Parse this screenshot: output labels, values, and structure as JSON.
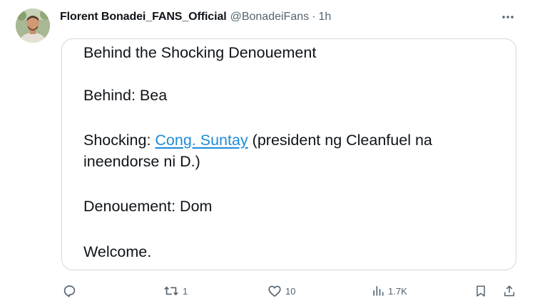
{
  "tweet": {
    "author": {
      "display_name": "Florent Bonadei_FANS_Official",
      "handle": "@BonadeiFans",
      "separator": "·",
      "time": "1h"
    },
    "card_lines": {
      "title": "Behind the Shocking Denouement",
      "behind": "Behind: Bea",
      "shocking_prefix": "Shocking: ",
      "shocking_link": "Cong. Suntay",
      "shocking_suffix": " (president ng Cleanfuel na",
      "shocking_line2": "ineendorse ni D.)",
      "denouement": "Denouement: Dom",
      "welcome": "Welcome."
    },
    "actions": {
      "reply_icon": "reply-icon",
      "retweet_icon": "retweet-icon",
      "retweet_count": "1",
      "like_icon": "heart-icon",
      "like_count": "10",
      "views_icon": "views-icon",
      "views_count": "1.7K",
      "bookmark_icon": "bookmark-icon",
      "share_icon": "share-icon"
    }
  },
  "colors": {
    "link": "#1d8bd8",
    "secondary_text": "#536471",
    "border": "#cfd9de"
  }
}
